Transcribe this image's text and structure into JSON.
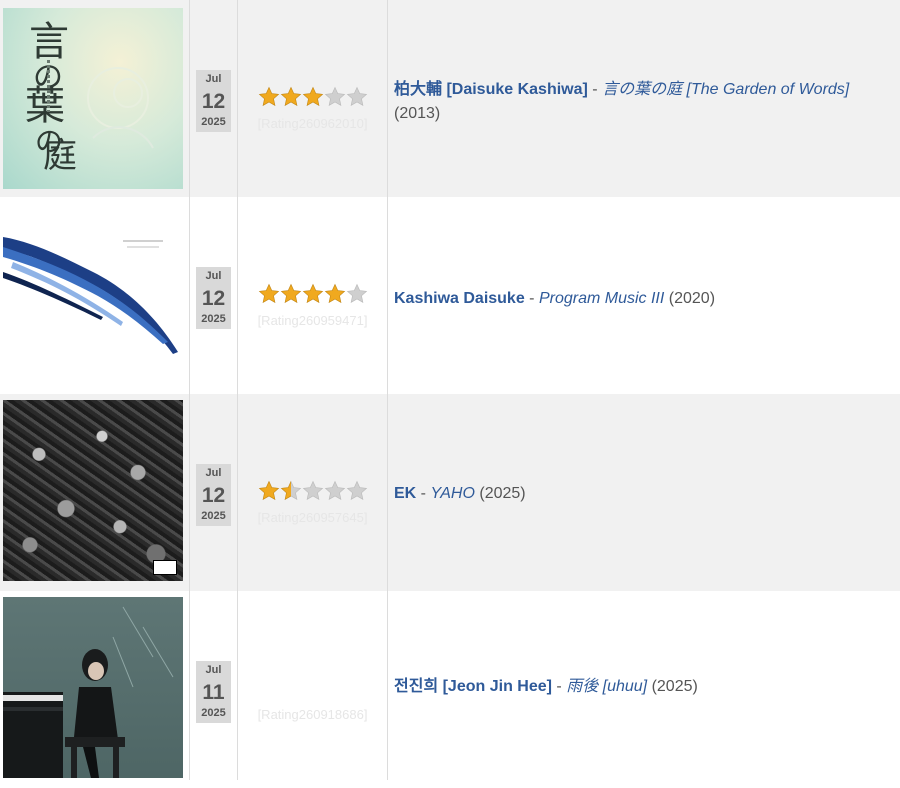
{
  "entries": [
    {
      "date": {
        "month": "Jul",
        "day": "12",
        "year": "2025"
      },
      "rating_stars": 3,
      "rating_text": "[Rating260962010]",
      "artist": "柏大輔 [Daisuke Kashiwa]",
      "album": "言の葉の庭 [The Garden of Words]",
      "release_year": "(2013)",
      "cover_label": "Garden of Words cover art"
    },
    {
      "date": {
        "month": "Jul",
        "day": "12",
        "year": "2025"
      },
      "rating_stars": 4,
      "rating_text": "[Rating260959471]",
      "artist": "Kashiwa Daisuke",
      "album": "Program Music III",
      "release_year": "(2020)",
      "cover_label": "Program Music III cover art"
    },
    {
      "date": {
        "month": "Jul",
        "day": "12",
        "year": "2025"
      },
      "rating_stars": 1.5,
      "rating_text": "[Rating260957645]",
      "artist": "EK",
      "album": "YAHO",
      "release_year": "(2025)",
      "cover_label": "YAHO cover art"
    },
    {
      "date": {
        "month": "Jul",
        "day": "11",
        "year": "2025"
      },
      "rating_stars": 0,
      "rating_text": "[Rating260918686]",
      "artist": "전진희 [Jeon Jin Hee]",
      "album": "雨後 [uhuu]",
      "release_year": "(2025)",
      "cover_label": "uhuu cover art"
    }
  ],
  "separator": " - ",
  "cover1_text": {
    "k1": "言",
    "k2": "の",
    "k3": "葉",
    "k4": "の",
    "k5": "庭"
  },
  "colors": {
    "link": "#2f5a99",
    "star_fill": "#f0a91f",
    "star_empty": "#cfcfcf",
    "row_alt": "#f1f1f1"
  }
}
